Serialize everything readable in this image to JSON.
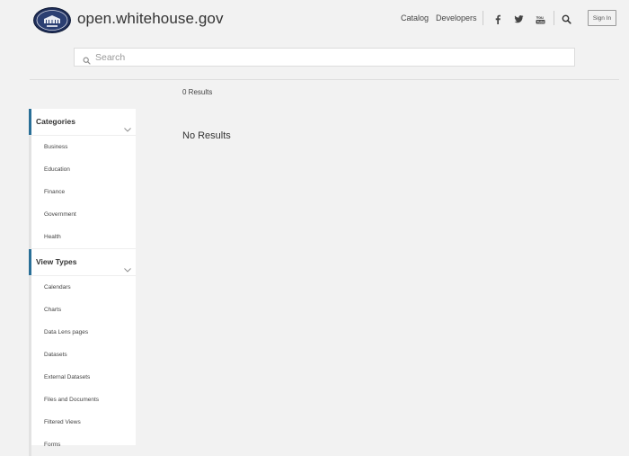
{
  "header": {
    "site_title": "open.whitehouse.gov",
    "nav": {
      "catalog": "Catalog",
      "developers": "Developers"
    },
    "icons": [
      "facebook-icon",
      "twitter-icon",
      "youtube-icon",
      "search-icon"
    ],
    "sign_in": "Sign In"
  },
  "search": {
    "placeholder": "Search",
    "value": ""
  },
  "results": {
    "count_label": "0 Results",
    "empty_message": "No Results"
  },
  "sidebar": {
    "categories": {
      "title": "Categories",
      "items": [
        "Business",
        "Education",
        "Finance",
        "Government",
        "Health"
      ]
    },
    "view_types": {
      "title": "View Types",
      "items": [
        "Calendars",
        "Charts",
        "Data Lens pages",
        "Datasets",
        "External Datasets",
        "Files and Documents",
        "Filtered Views",
        "Forms"
      ]
    }
  },
  "colors": {
    "accent": "#2a6f97",
    "background": "#f2f2f2",
    "panel": "#ffffff",
    "seal": "#1f2f5a"
  }
}
